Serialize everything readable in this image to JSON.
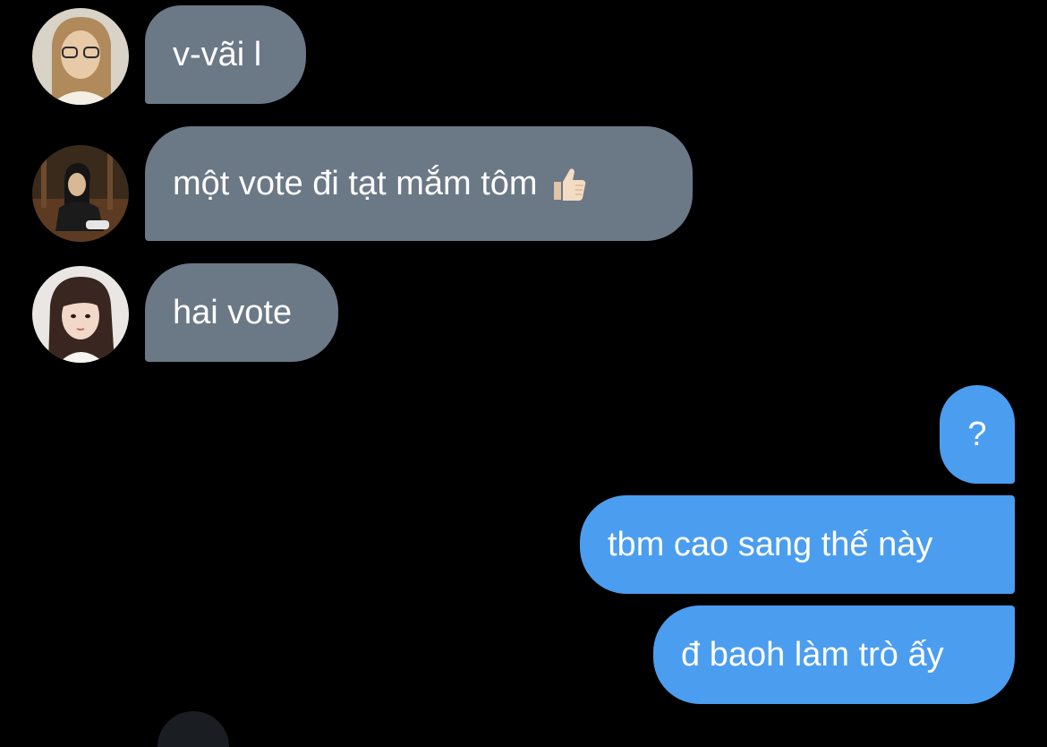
{
  "messages": [
    {
      "direction": "incoming",
      "sender_avatar": "avatar-blonde-glasses",
      "text": "v-vãi l"
    },
    {
      "direction": "incoming",
      "sender_avatar": "avatar-dark-sitting",
      "text": "một vote đi tạt mắm tôm",
      "emoji": "thumbs-up-icon"
    },
    {
      "direction": "incoming",
      "sender_avatar": "avatar-dark-hair-portrait",
      "text": "hai vote"
    },
    {
      "direction": "outgoing",
      "text": "?"
    },
    {
      "direction": "outgoing",
      "text": "tbm cao sang thế này"
    },
    {
      "direction": "outgoing",
      "text": "đ baoh làm trò ấy"
    }
  ],
  "colors": {
    "background": "#000000",
    "incoming_bubble": "#6b7886",
    "outgoing_bubble": "#4b9df0",
    "text": "#ffffff"
  }
}
